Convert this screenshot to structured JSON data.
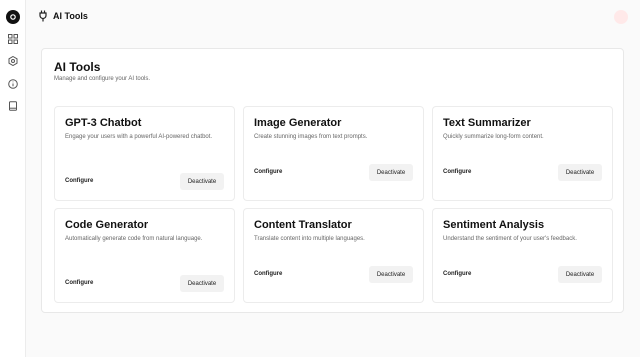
{
  "header": {
    "title": "AI Tools"
  },
  "panel": {
    "title": "AI Tools",
    "subtitle": "Manage and configure your AI tools."
  },
  "tools": [
    {
      "name": "GPT-3 Chatbot",
      "description": "Engage your users with a powerful AI-powered chatbot.",
      "configure_label": "Configure",
      "deactivate_label": "Deactivate"
    },
    {
      "name": "Image Generator",
      "description": "Create stunning images from text prompts.",
      "configure_label": "Configure",
      "deactivate_label": "Deactivate"
    },
    {
      "name": "Text Summarizer",
      "description": "Quickly summarize long-form content.",
      "configure_label": "Configure",
      "deactivate_label": "Deactivate"
    },
    {
      "name": "Code Generator",
      "description": "Automatically generate code from natural language.",
      "configure_label": "Configure",
      "deactivate_label": "Deactivate"
    },
    {
      "name": "Content Translator",
      "description": "Translate content into multiple languages.",
      "configure_label": "Configure",
      "deactivate_label": "Deactivate"
    },
    {
      "name": "Sentiment Analysis",
      "description": "Understand the sentiment of your user's feedback.",
      "configure_label": "Configure",
      "deactivate_label": "Deactivate"
    }
  ],
  "icons": {
    "logo": "logo-icon",
    "nav": [
      "dashboard-icon",
      "settings-icon",
      "info-icon",
      "book-icon"
    ],
    "header": "plug-icon"
  },
  "colors": {
    "accent": "#111111",
    "avatar": "#ffe9e9",
    "button_bg": "#f2f2f2"
  }
}
